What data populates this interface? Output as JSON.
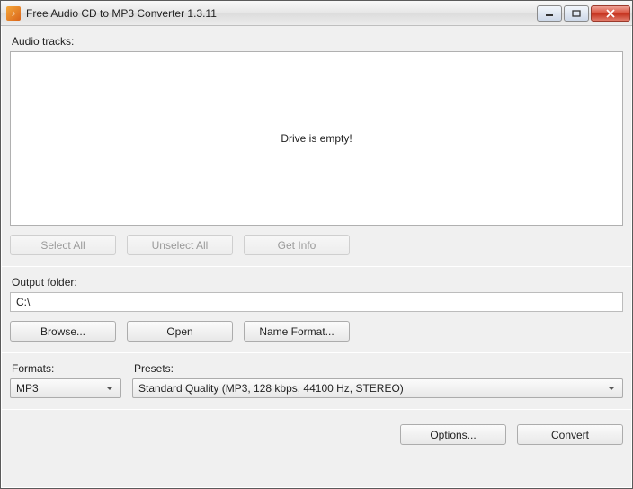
{
  "window": {
    "title": "Free Audio CD to MP3 Converter 1.3.11"
  },
  "tracks": {
    "label": "Audio tracks:",
    "empty_message": "Drive is empty!",
    "buttons": {
      "select_all": "Select All",
      "unselect_all": "Unselect All",
      "get_info": "Get Info"
    }
  },
  "output": {
    "label": "Output folder:",
    "path": "C:\\",
    "buttons": {
      "browse": "Browse...",
      "open": "Open",
      "name_format": "Name Format..."
    }
  },
  "formats": {
    "label": "Formats:",
    "selected": "MP3"
  },
  "presets": {
    "label": "Presets:",
    "selected": "Standard Quality (MP3, 128 kbps, 44100 Hz, STEREO)"
  },
  "footer": {
    "options": "Options...",
    "convert": "Convert"
  }
}
